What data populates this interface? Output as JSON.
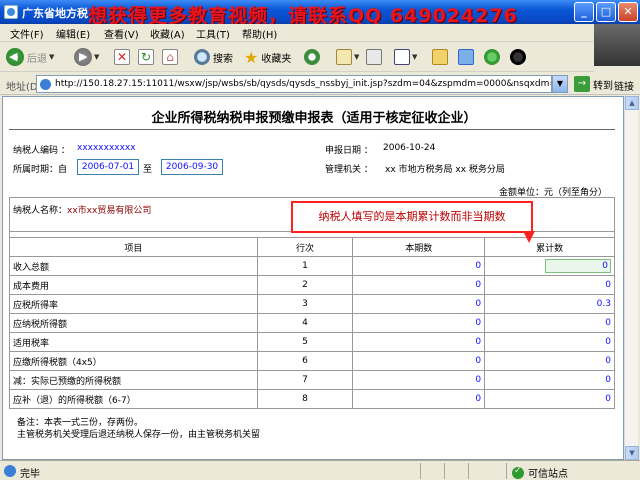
{
  "window": {
    "title": "广东省地方税",
    "watermark": "想获得更多教育视频，请联系QQ 649024276",
    "minimize": "_",
    "maximize": "□",
    "close": "✕"
  },
  "menu": [
    "文件(F)",
    "编辑(E)",
    "查看(V)",
    "收藏(A)",
    "工具(T)",
    "帮助(H)"
  ],
  "toolbar": {
    "back": "后退",
    "search": "搜索",
    "favorites": "收藏夹"
  },
  "address": {
    "label": "地址(D)",
    "url": "http://150.18.27.15:11011/wsxw/jsp/wsbs/sb/qysds/qysds_nssbyj_init.jsp?szdm=04&zspmdm=0000&nsqxdm=30",
    "go": "转到",
    "links": "链接"
  },
  "form": {
    "title": "企业所得税纳税申报预缴申报表（适用于核定征收企业）",
    "taxpayer_code_label": "纳税人编码 ：",
    "taxpayer_code": "xxxxxxxxxxx",
    "declare_date_label": "申报日期 ：",
    "declare_date": "2006-10-24",
    "period_label": "所属时期：自",
    "period_from": "2006-07-01",
    "period_to_label": "至",
    "period_to": "2006-09-30",
    "authority_label": "管理机关 ：",
    "authority": "xx 市地方税务局 xx 税务分局",
    "unit_note": "金额单位：元（列至角分）",
    "taxpayer_name_label": "纳税人名称：",
    "taxpayer_name": "xx市xx贸易有限公司",
    "headers": {
      "item": "项目",
      "row": "行次",
      "current": "本期数",
      "cumulative": "累计数"
    },
    "rows": [
      {
        "item": "收入总额",
        "row": "1",
        "current": "0",
        "cumulative": "0"
      },
      {
        "item": "成本费用",
        "row": "2",
        "current": "0",
        "cumulative": "0"
      },
      {
        "item": "应税所得率",
        "row": "3",
        "current": "0",
        "cumulative": "0.3"
      },
      {
        "item": "应纳税所得额",
        "row": "4",
        "current": "0",
        "cumulative": "0"
      },
      {
        "item": "适用税率",
        "row": "5",
        "current": "0",
        "cumulative": "0"
      },
      {
        "item": "应缴所得税额（4x5）",
        "row": "6",
        "current": "0",
        "cumulative": "0"
      },
      {
        "item": "减：实际已预缴的所得税额",
        "row": "7",
        "current": "0",
        "cumulative": "0"
      },
      {
        "item": "应补（退）的所得税额（6-7）",
        "row": "8",
        "current": "0",
        "cumulative": "0"
      }
    ],
    "note1": "备注：本表一式三份，存两份。",
    "note2": "主管税务机关受理后退还纳税人保存一份，由主管税务机关留",
    "callout": "纳税人填写的是本期累计数而非当期数"
  },
  "status": {
    "text": "完毕",
    "zone": "可信站点"
  }
}
